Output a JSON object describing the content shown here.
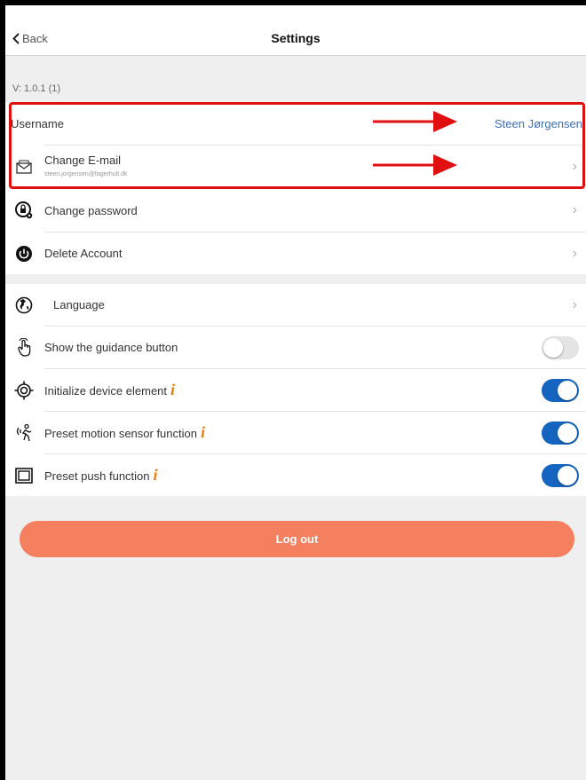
{
  "nav": {
    "back_label": "Back",
    "title": "Settings"
  },
  "version": "V: 1.0.1 (1)",
  "account": {
    "username_label": "Username",
    "username_value": "Steen Jørgensen",
    "change_email_label": "Change E-mail",
    "email_value": "steen.jorgensen@fagerhult.dk",
    "change_password_label": "Change password",
    "delete_account_label": "Delete Account"
  },
  "preferences": {
    "language_label": "Language",
    "guidance_label": "Show the guidance button",
    "guidance_on": false,
    "initialize_label": "Initialize device element",
    "initialize_on": true,
    "motion_label": "Preset motion sensor function",
    "motion_on": true,
    "push_label": "Preset push function",
    "push_on": true,
    "info_glyph": "i"
  },
  "logout_label": "Log out",
  "colors": {
    "accent_blue": "#1565c0",
    "logout": "#f5805f",
    "info": "#ee7d0c",
    "annotation_red": "#e01010"
  }
}
